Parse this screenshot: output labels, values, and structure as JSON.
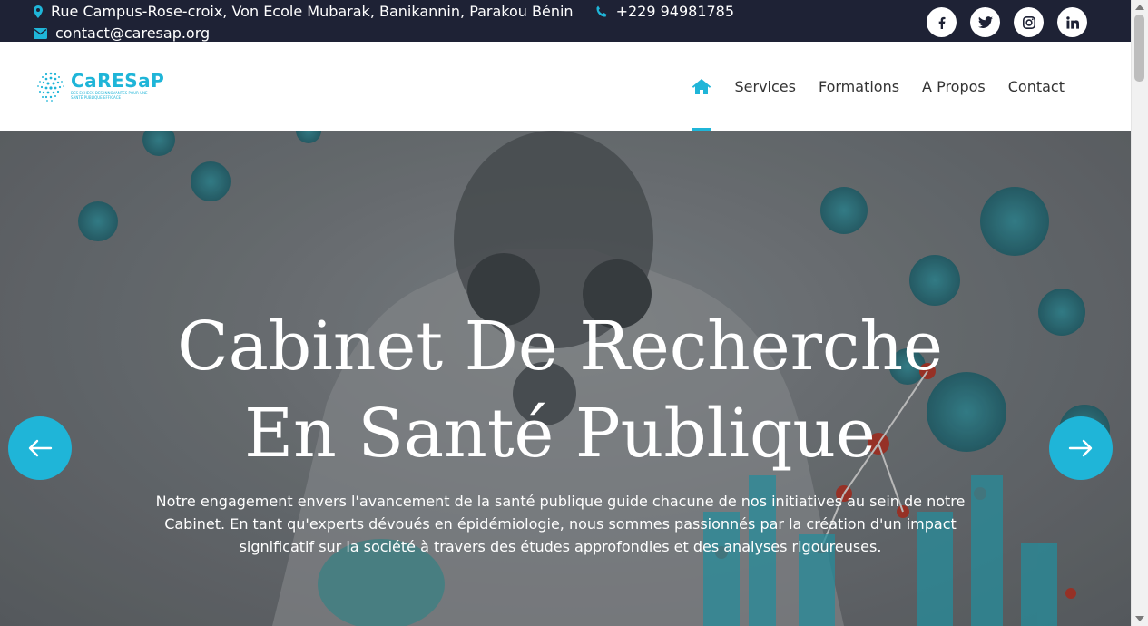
{
  "topbar": {
    "address": "Rue Campus-Rose-croix, Von Ecole Mubarak, Banikannin, Parakou Bénin",
    "phone": "+229 94981785",
    "email": "contact@caresap.org",
    "social": [
      "facebook-icon",
      "twitter-icon",
      "instagram-icon",
      "linkedin-icon"
    ]
  },
  "logo": {
    "brand": "CaRESaP",
    "tagline": "DES ECHECS DES INNOVANTES POUR UNE SANTÉ PUBLIQUE EFFICACE"
  },
  "nav": {
    "items": [
      "Services",
      "Formations",
      "A Propos",
      "Contact"
    ],
    "active": "home"
  },
  "hero": {
    "title_line1": "Cabinet De Recherche",
    "title_line2": "En Santé Publique",
    "description": "Notre engagement envers l'avancement de la santé publique guide chacune de nos initiatives au sein de notre Cabinet. En tant qu'experts dévoués en épidémiologie, nous sommes passionnés par la création d'un impact significatif sur la société à travers des études approfondies et des analyses rigoureuses."
  },
  "colors": {
    "accent": "#1fb5d8",
    "topbar": "#1e2235"
  }
}
